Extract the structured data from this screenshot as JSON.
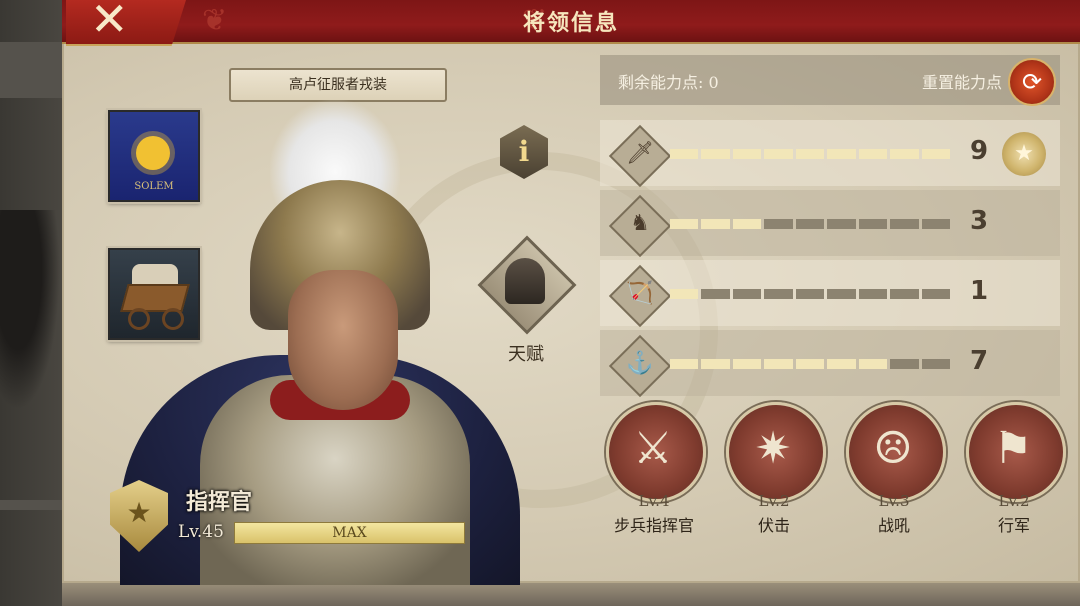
{
  "header": {
    "title": "将领信息"
  },
  "outfit": {
    "label": "高卢征服者戎装"
  },
  "banner_slot": {
    "text": "SOLEM"
  },
  "commander": {
    "title": "指挥官",
    "level": "Lv.45",
    "exp_label": "MAX",
    "exp_fill": 1.0
  },
  "talent": {
    "label": "天赋"
  },
  "stats_panel": {
    "remaining_label": "剩余能力点:",
    "remaining_value": "0",
    "reset_label": "重置能力点"
  },
  "stats": [
    {
      "icon": "sword-icon",
      "glyph": "🗡",
      "value": "9",
      "max": 9,
      "badge": true
    },
    {
      "icon": "horse-icon",
      "glyph": "♞",
      "value": "3",
      "max": 9,
      "badge": false
    },
    {
      "icon": "bow-icon",
      "glyph": "🏹",
      "value": "1",
      "max": 9,
      "badge": false
    },
    {
      "icon": "anchor-icon",
      "glyph": "⚓",
      "value": "7",
      "max": 9,
      "badge": false
    }
  ],
  "skills": [
    {
      "icon": "crossed-swords-icon",
      "glyph": "⚔",
      "level": "Lv.4",
      "name": "步兵指挥官"
    },
    {
      "icon": "ambush-icon",
      "glyph": "✷",
      "level": "Lv.2",
      "name": "伏击"
    },
    {
      "icon": "war-cry-icon",
      "glyph": "☹",
      "level": "Lv.3",
      "name": "战吼"
    },
    {
      "icon": "march-icon",
      "glyph": "⚑",
      "level": "Lv.2",
      "name": "行军"
    }
  ],
  "colors": {
    "header": "#8f1b1b",
    "accent_gold": "#c9a35a",
    "bar_on": "#f2e6b8",
    "bar_off": "#8c8370"
  }
}
